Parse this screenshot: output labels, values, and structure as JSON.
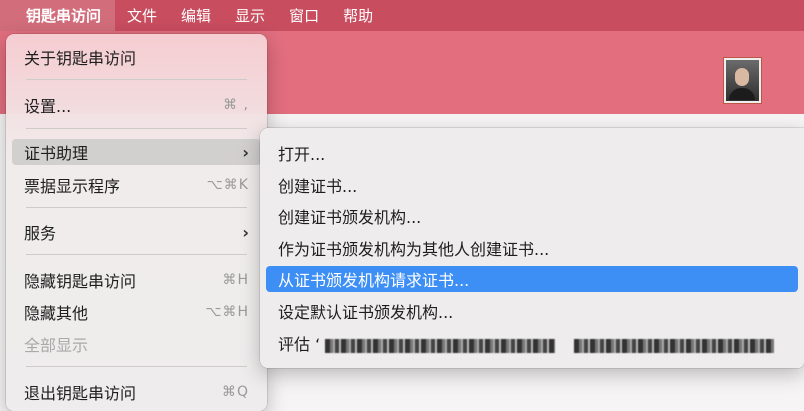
{
  "menubar": {
    "items": [
      "钥匙串访问",
      "文件",
      "编辑",
      "显示",
      "窗口",
      "帮助"
    ]
  },
  "main_menu": {
    "items": [
      {
        "label": "关于钥匙串访问",
        "shortcut": ""
      },
      {
        "label": "设置...",
        "shortcut": "⌘ ,"
      },
      {
        "label": "证书助理",
        "shortcut": "",
        "submenu": true
      },
      {
        "label": "票据显示程序",
        "shortcut": "⌥⌘K"
      },
      {
        "label": "服务",
        "shortcut": "",
        "submenu": true
      },
      {
        "label": "隐藏钥匙串访问",
        "shortcut": "⌘H"
      },
      {
        "label": "隐藏其他",
        "shortcut": "⌥⌘H"
      },
      {
        "label": "全部显示",
        "shortcut": "",
        "disabled": true
      },
      {
        "label": "退出钥匙串访问",
        "shortcut": "⌘Q"
      }
    ],
    "submenu_glyph": "›"
  },
  "submenu": {
    "items": [
      {
        "label": "打开..."
      },
      {
        "label": "创建证书..."
      },
      {
        "label": "创建证书颁发机构..."
      },
      {
        "label": "作为证书颁发机构为其他人创建证书..."
      },
      {
        "label": "从证书颁发机构请求证书...",
        "highlighted": true
      },
      {
        "label": "设定默认证书颁发机构..."
      },
      {
        "label": "评估 ‘"
      }
    ]
  },
  "colors": {
    "menubar": "#c84d5f",
    "toolbar": "#e26e7e",
    "highlight": "#3d8ff5"
  },
  "icons": {
    "avatar": "user-photo",
    "chevron": "chevron-right-icon"
  }
}
